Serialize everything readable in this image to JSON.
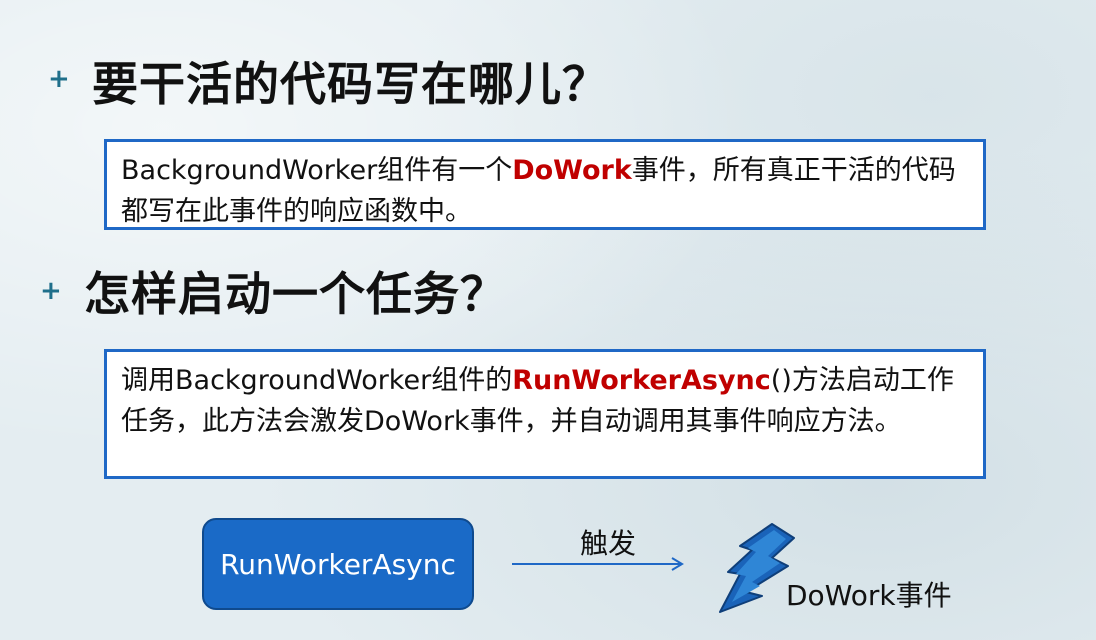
{
  "section1": {
    "bullet": "+",
    "heading": "要干活的代码写在哪儿？",
    "box": {
      "part1": "BackgroundWorker",
      "part2": "组件有一个",
      "highlight": "DoWork",
      "part3": "事件，所有真正干活的代码都写在此事件的响应函数中。"
    }
  },
  "section2": {
    "bullet": "+",
    "heading": "怎样启动一个任务？",
    "box": {
      "part1": "调用",
      "part2": "BackgroundWorker",
      "part3": "组件的",
      "highlight": "RunWorkerAsync",
      "part4": "()",
      "part5": "方法启动工作任务，此方法会激发",
      "part6": "DoWork",
      "part7": "事件，并自动调用其事件响应方法。"
    }
  },
  "diagram": {
    "button_label": "RunWorkerAsync",
    "arrow_label": "触发",
    "event_label_latin": "DoWork",
    "event_label_cn": "事件"
  },
  "colors": {
    "accent_blue": "#1f68c6",
    "highlight_red": "#c00000",
    "bullet_teal": "#1f6f8b"
  }
}
